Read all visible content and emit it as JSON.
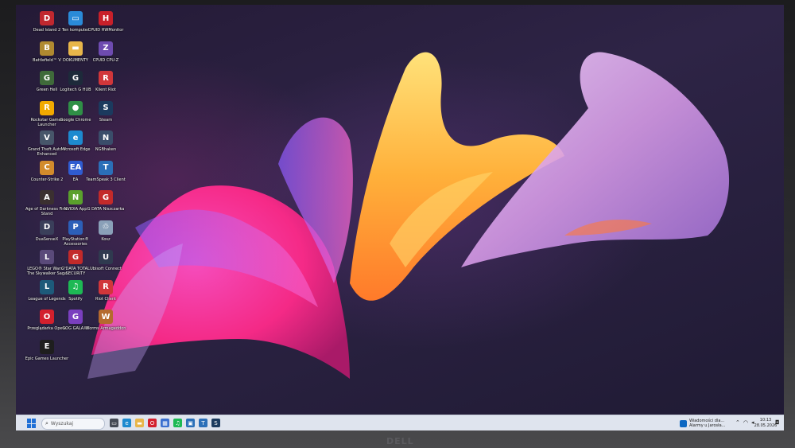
{
  "desktop": {
    "icons": [
      {
        "label": "Dead Island 2",
        "glyph": "D",
        "color": "#c0282f",
        "icon": "dead-island-2-icon"
      },
      {
        "label": "Ten komputer",
        "glyph": "▭",
        "color": "#2a8ad8",
        "icon": "computer-icon"
      },
      {
        "label": "CPUID HWMonitor",
        "glyph": "H",
        "color": "#c8202a",
        "icon": "hwmonitor-icon"
      },
      {
        "label": "Battlefield™ V",
        "glyph": "B",
        "color": "#b08a30",
        "icon": "battlefield-icon"
      },
      {
        "label": "DOKUMENTY",
        "glyph": "▬",
        "color": "#e8b64a",
        "icon": "folder-icon"
      },
      {
        "label": "CPUID CPU-Z",
        "glyph": "Z",
        "color": "#6e4bb0",
        "icon": "cpuz-icon"
      },
      {
        "label": "Green Hell",
        "glyph": "G",
        "color": "#3f6a3a",
        "icon": "green-hell-icon"
      },
      {
        "label": "Logitech G HUB",
        "glyph": "G",
        "color": "#1d2a3a",
        "icon": "logitech-icon"
      },
      {
        "label": "Klient Riot",
        "glyph": "R",
        "color": "#d1363a",
        "icon": "riot-client-icon"
      },
      {
        "label": "Rockstar Games Launcher",
        "glyph": "R",
        "color": "#f2a900",
        "icon": "rockstar-icon"
      },
      {
        "label": "Google Chrome",
        "glyph": "●",
        "color": "#2f8f46",
        "icon": "chrome-icon"
      },
      {
        "label": "Steam",
        "glyph": "S",
        "color": "#1b3a5e",
        "icon": "steam-icon"
      },
      {
        "label": "Grand Theft Auto V Enhanced",
        "glyph": "V",
        "color": "#47566a",
        "icon": "gta-icon"
      },
      {
        "label": "Microsoft Edge",
        "glyph": "e",
        "color": "#1d8acf",
        "icon": "edge-icon"
      },
      {
        "label": "NGBhaken",
        "glyph": "N",
        "color": "#3a4d6a",
        "icon": "ngbhaken-icon"
      },
      {
        "label": "Counter-Strike 2",
        "glyph": "C",
        "color": "#d28b2c",
        "icon": "counter-strike-icon"
      },
      {
        "label": "EA",
        "glyph": "EA",
        "color": "#2f5bd0",
        "icon": "ea-icon"
      },
      {
        "label": "TeamSpeak 3 Client",
        "glyph": "T",
        "color": "#2b6fb8",
        "icon": "teamspeak-icon"
      },
      {
        "label": "Age of Darkness Final Stand",
        "glyph": "A",
        "color": "#3b3030",
        "icon": "age-of-darkness-icon"
      },
      {
        "label": "NVIDIA App",
        "glyph": "N",
        "color": "#5aa02c",
        "icon": "nvidia-icon"
      },
      {
        "label": "G DATA Niszczarka",
        "glyph": "G",
        "color": "#c32a2a",
        "icon": "gdata-shredder-icon"
      },
      {
        "label": "DuaSenseX",
        "glyph": "D",
        "color": "#3a3f5a",
        "icon": "dualsensex-icon"
      },
      {
        "label": "PlayStation® Accessories",
        "glyph": "P",
        "color": "#2c5fb8",
        "icon": "playstation-icon"
      },
      {
        "label": "Kosz",
        "glyph": "♲",
        "color": "#8aa0b8",
        "icon": "recycle-bin-icon"
      },
      {
        "label": "LEGO® Star Wars™ The Skywalker Saga",
        "glyph": "L",
        "color": "#5a4a7a",
        "icon": "lego-star-wars-icon"
      },
      {
        "label": "G DATA TOTAL SECURITY",
        "glyph": "G",
        "color": "#c32a2a",
        "icon": "gdata-security-icon"
      },
      {
        "label": "Ubisoft Connect",
        "glyph": "U",
        "color": "#2f3a4f",
        "icon": "ubisoft-icon"
      },
      {
        "label": "League of Legends",
        "glyph": "L",
        "color": "#1d5a7a",
        "icon": "league-icon"
      },
      {
        "label": "Spotify",
        "glyph": "♫",
        "color": "#1db954",
        "icon": "spotify-icon"
      },
      {
        "label": "Riot Client",
        "glyph": "R",
        "color": "#d1363a",
        "icon": "riot-client-2-icon"
      },
      {
        "label": "Przeglądarka Opera",
        "glyph": "O",
        "color": "#d3202d",
        "icon": "opera-icon"
      },
      {
        "label": "GOG GALAXY",
        "glyph": "G",
        "color": "#7a3fbf",
        "icon": "gog-galaxy-icon"
      },
      {
        "label": "Worms Armageddon",
        "glyph": "W",
        "color": "#b56a2e",
        "icon": "worms-icon"
      },
      {
        "label": "Epic Games Launcher",
        "glyph": "E",
        "color": "#1e1e1e",
        "icon": "epic-games-icon"
      }
    ]
  },
  "taskbar": {
    "search_placeholder": "Wyszukaj",
    "apps": [
      {
        "icon": "task-view-icon",
        "glyph": "▭",
        "color": "#444a55"
      },
      {
        "icon": "edge-icon",
        "glyph": "e",
        "color": "#1d8acf"
      },
      {
        "icon": "file-explorer-icon",
        "glyph": "▬",
        "color": "#e8b64a"
      },
      {
        "icon": "opera-icon",
        "glyph": "O",
        "color": "#d3202d"
      },
      {
        "icon": "ms-store-icon",
        "glyph": "▦",
        "color": "#3a6fd0"
      },
      {
        "icon": "spotify-icon",
        "glyph": "♫",
        "color": "#1db954"
      },
      {
        "icon": "ms-store-icon",
        "glyph": "▣",
        "color": "#2a6fb8"
      },
      {
        "icon": "teamspeak-icon",
        "glyph": "T",
        "color": "#2b6fb8"
      },
      {
        "icon": "steam-icon",
        "glyph": "S",
        "color": "#1b3a5e"
      }
    ],
    "notification": {
      "line1": "Wiadomości dla...",
      "line2": "Alarmy u Jarosła..."
    },
    "clock": {
      "time": "10:13",
      "date": "28.05.2026"
    }
  },
  "monitor": {
    "brand": "DELL"
  }
}
